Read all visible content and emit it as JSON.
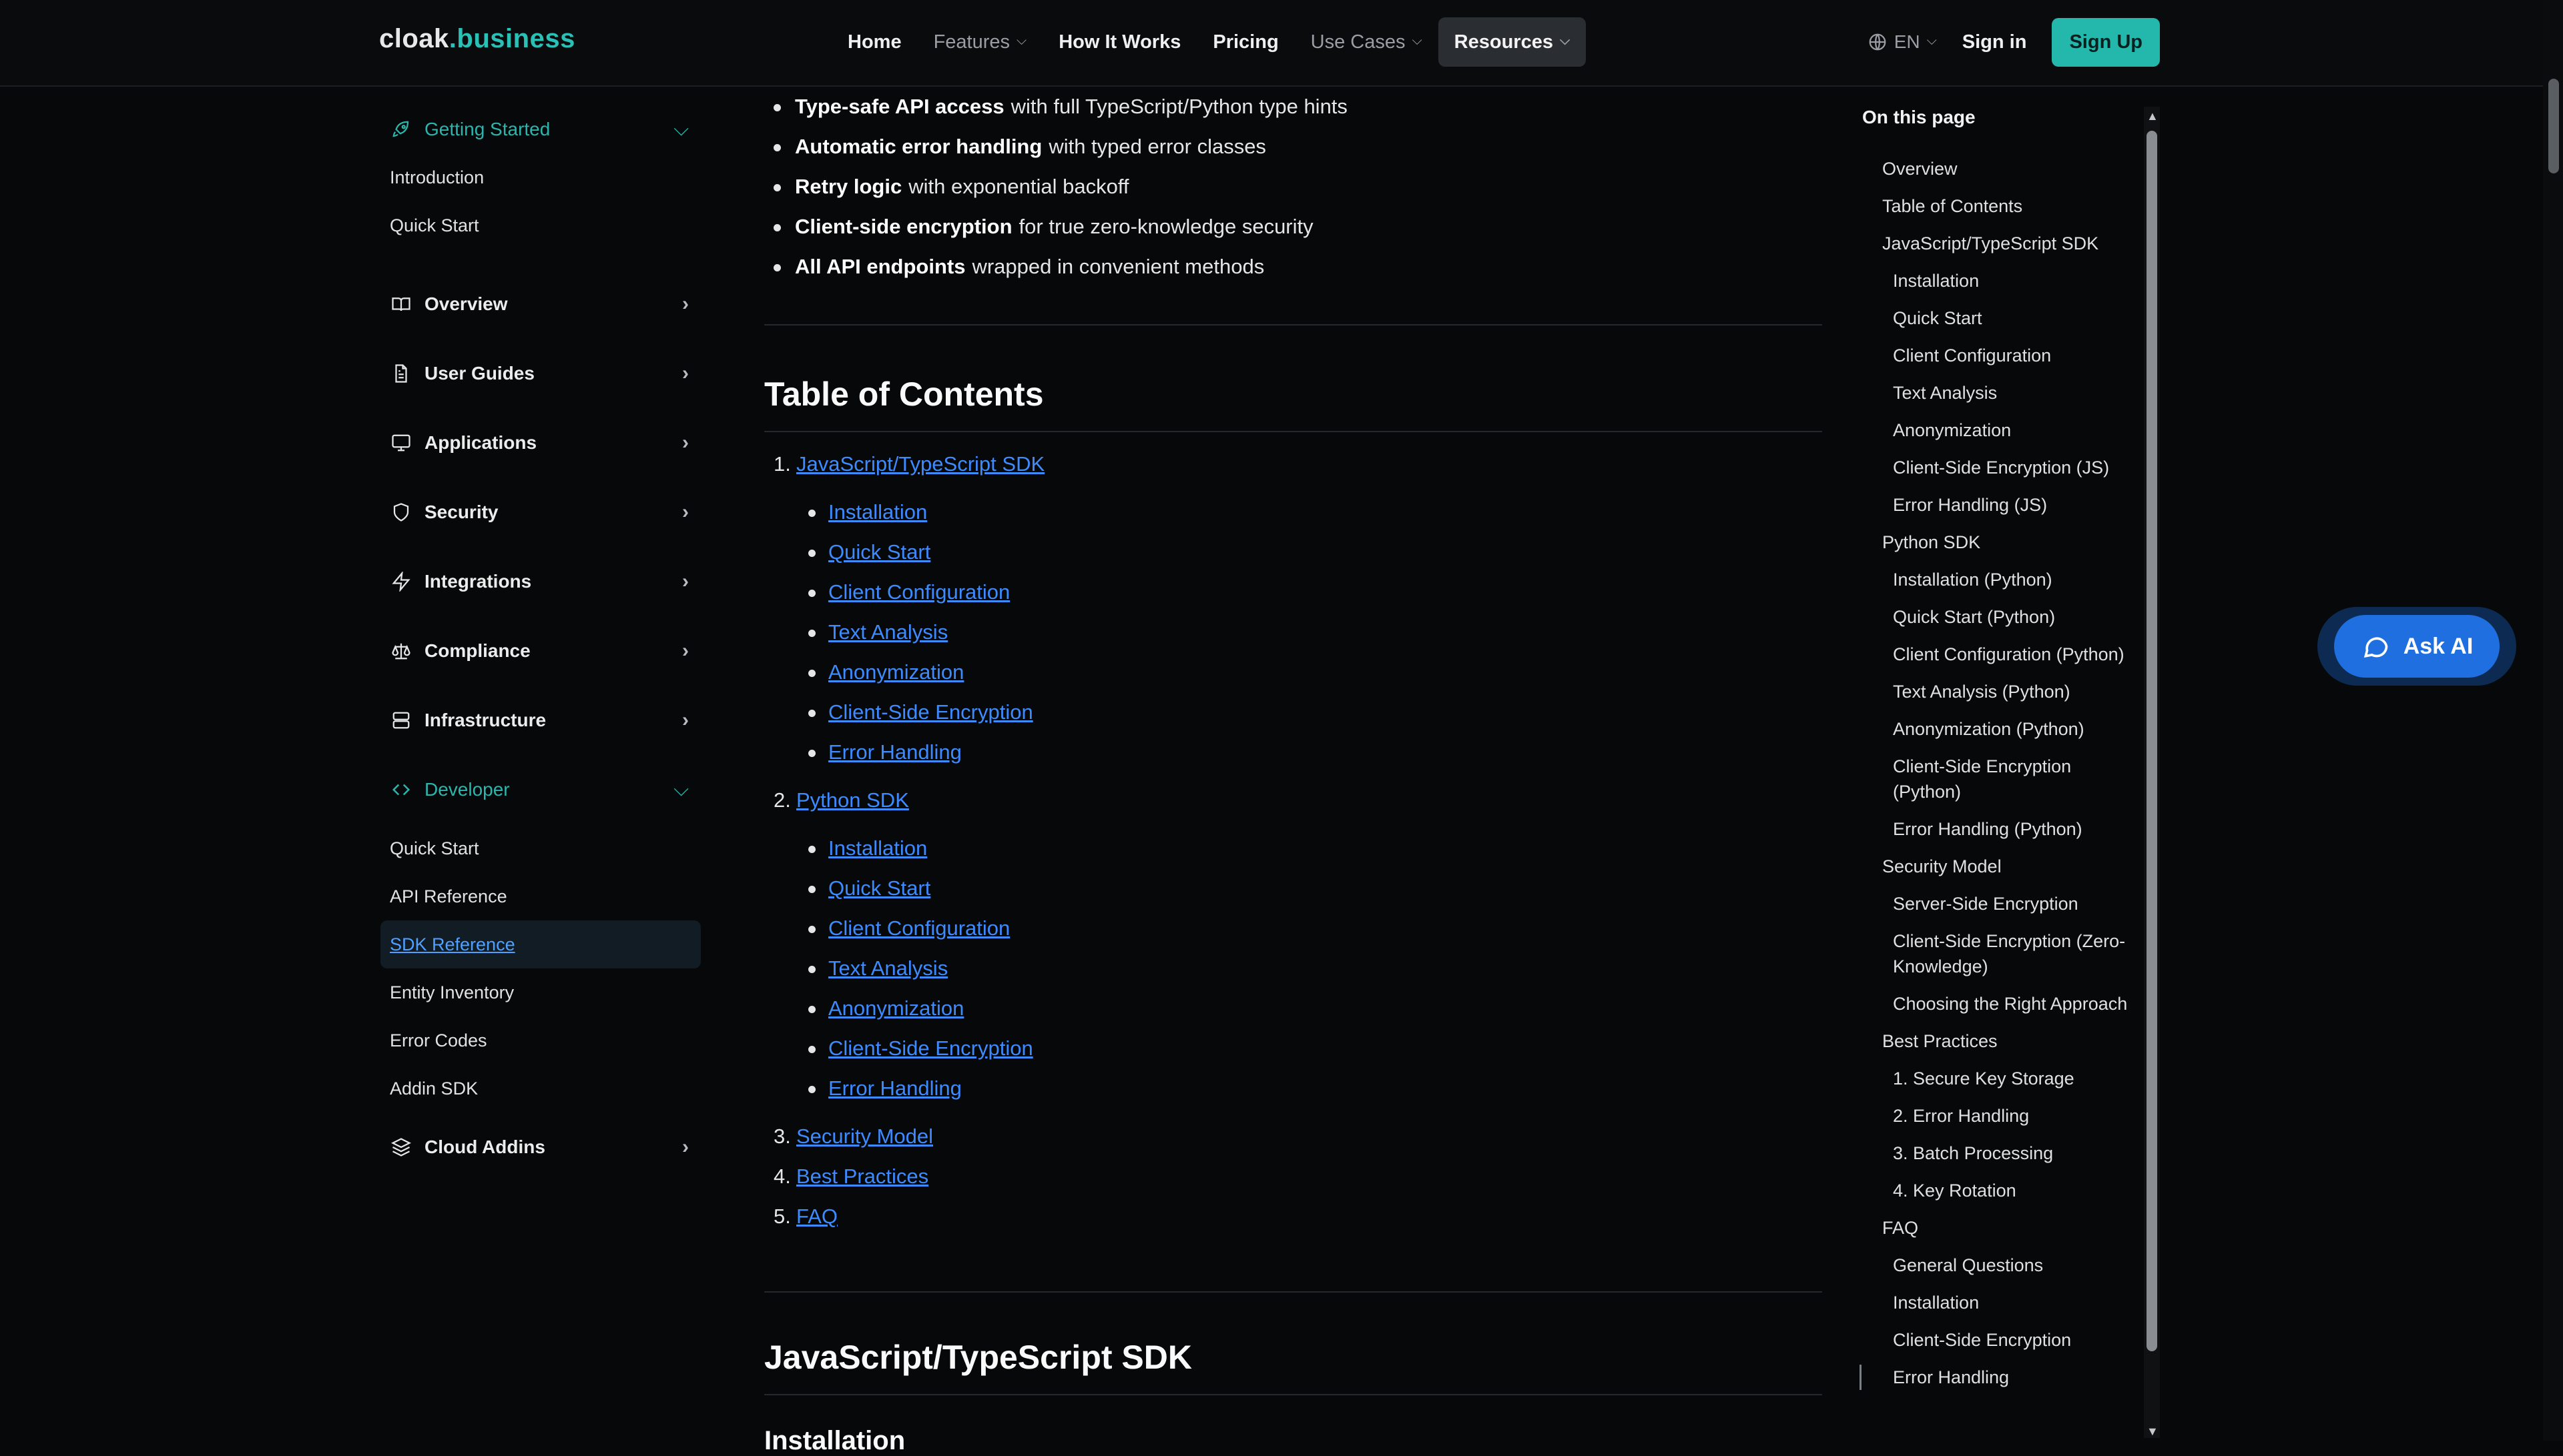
{
  "header": {
    "logo": {
      "a": "cloak",
      "dot": ".",
      "b": "business"
    },
    "nav": [
      {
        "label": "Home",
        "dropdown": false
      },
      {
        "label": "Features",
        "dropdown": true
      },
      {
        "label": "How It Works",
        "dropdown": false
      },
      {
        "label": "Pricing",
        "dropdown": false
      },
      {
        "label": "Use Cases",
        "dropdown": true
      },
      {
        "label": "Resources",
        "dropdown": true
      }
    ],
    "lang": "EN",
    "sign_in": "Sign in",
    "sign_up": "Sign Up"
  },
  "sidebar": {
    "getting_started": {
      "label": "Getting Started",
      "items": [
        "Introduction",
        "Quick Start"
      ]
    },
    "sections": [
      "Overview",
      "User Guides",
      "Applications",
      "Security",
      "Integrations",
      "Compliance",
      "Infrastructure"
    ],
    "developer": {
      "label": "Developer",
      "items": [
        "Quick Start",
        "API Reference",
        "SDK Reference",
        "Entity Inventory",
        "Error Codes",
        "Addin SDK"
      ],
      "current": "SDK Reference"
    },
    "cloud_addins": "Cloud Addins"
  },
  "main": {
    "features": [
      {
        "bold": "Type-safe API access",
        "rest": "with full TypeScript/Python type hints"
      },
      {
        "bold": "Automatic error handling",
        "rest": "with typed error classes"
      },
      {
        "bold": "Retry logic",
        "rest": "with exponential backoff"
      },
      {
        "bold": "Client-side encryption",
        "rest": "for true zero-knowledge security"
      },
      {
        "bold": "All API endpoints",
        "rest": "wrapped in convenient methods"
      }
    ],
    "toc_heading": "Table of Contents",
    "toc": [
      {
        "num": "1.",
        "label": "JavaScript/TypeScript SDK",
        "subs": [
          "Installation",
          "Quick Start",
          "Client Configuration",
          "Text Analysis",
          "Anonymization",
          "Client-Side Encryption",
          "Error Handling"
        ]
      },
      {
        "num": "2.",
        "label": "Python SDK",
        "subs": [
          "Installation",
          "Quick Start",
          "Client Configuration",
          "Text Analysis",
          "Anonymization",
          "Client-Side Encryption",
          "Error Handling"
        ]
      },
      {
        "num": "3.",
        "label": "Security Model",
        "subs": []
      },
      {
        "num": "4.",
        "label": "Best Practices",
        "subs": []
      },
      {
        "num": "5.",
        "label": "FAQ",
        "subs": []
      }
    ],
    "js_heading": "JavaScript/TypeScript SDK",
    "install_heading": "Installation"
  },
  "on_this_page": {
    "title": "On this page",
    "groups": [
      {
        "label": "Overview",
        "subs": []
      },
      {
        "label": "Table of Contents",
        "subs": []
      },
      {
        "label": "JavaScript/TypeScript SDK",
        "subs": [
          "Installation",
          "Quick Start",
          "Client Configuration",
          "Text Analysis",
          "Anonymization",
          "Client-Side Encryption (JS)",
          "Error Handling (JS)"
        ]
      },
      {
        "label": "Python SDK",
        "subs": [
          "Installation (Python)",
          "Quick Start (Python)",
          "Client Configuration (Python)",
          "Text Analysis (Python)",
          "Anonymization (Python)",
          "Client-Side Encryption (Python)",
          "Error Handling (Python)"
        ]
      },
      {
        "label": "Security Model",
        "subs": [
          "Server-Side Encryption",
          "Client-Side Encryption (Zero-Knowledge)",
          "Choosing the Right Approach"
        ]
      },
      {
        "label": "Best Practices",
        "subs": [
          "1. Secure Key Storage",
          "2. Error Handling",
          "3. Batch Processing",
          "4. Key Rotation"
        ]
      },
      {
        "label": "FAQ",
        "subs": [
          "General Questions",
          "Installation",
          "Client-Side Encryption",
          "Error Handling"
        ]
      }
    ],
    "active": "Error Handling"
  },
  "ask_ai": "Ask AI",
  "colors": {
    "accent": "#24b7ac",
    "link": "#3d8bff",
    "ask_ai": "#1f6fe0"
  }
}
